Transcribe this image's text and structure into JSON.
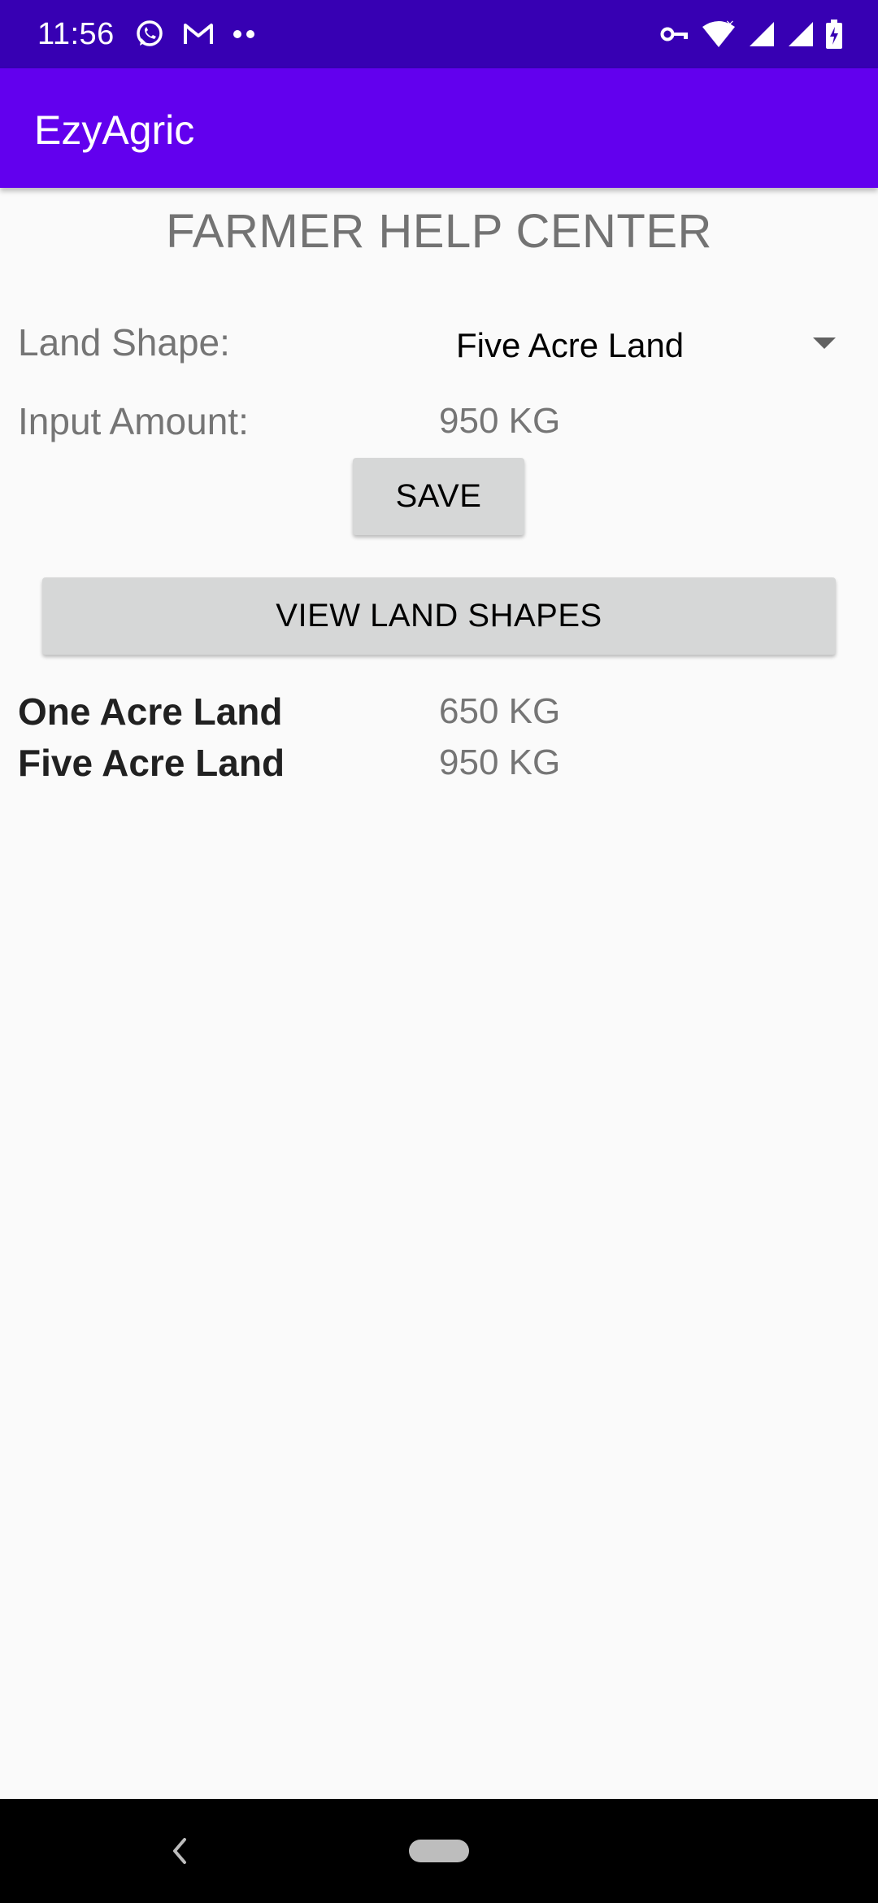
{
  "status_bar": {
    "time": "11:56",
    "left_icons": [
      "whatsapp-icon",
      "gmail-icon",
      "more-dots-icon"
    ],
    "right_icons": [
      "vpn-key-icon",
      "wifi-icon",
      "signal-icon",
      "signal-icon-2",
      "battery-charging-icon"
    ]
  },
  "app_bar": {
    "title": "EzyAgric"
  },
  "form": {
    "title": "FARMER HELP CENTER",
    "land_shape_label": "Land Shape:",
    "land_shape_selected": "Five Acre Land",
    "input_amount_label": "Input Amount:",
    "input_amount_value": "950 KG",
    "save_label": "SAVE",
    "view_label": "VIEW LAND SHAPES"
  },
  "shapes": [
    {
      "name": "One Acre Land",
      "amount": "650 KG"
    },
    {
      "name": "Five Acre Land",
      "amount": "950 KG"
    }
  ],
  "colors": {
    "status_bar": "#3700b3",
    "app_bar": "#6200ee",
    "button": "#d6d7d7",
    "background": "#fafafa"
  }
}
